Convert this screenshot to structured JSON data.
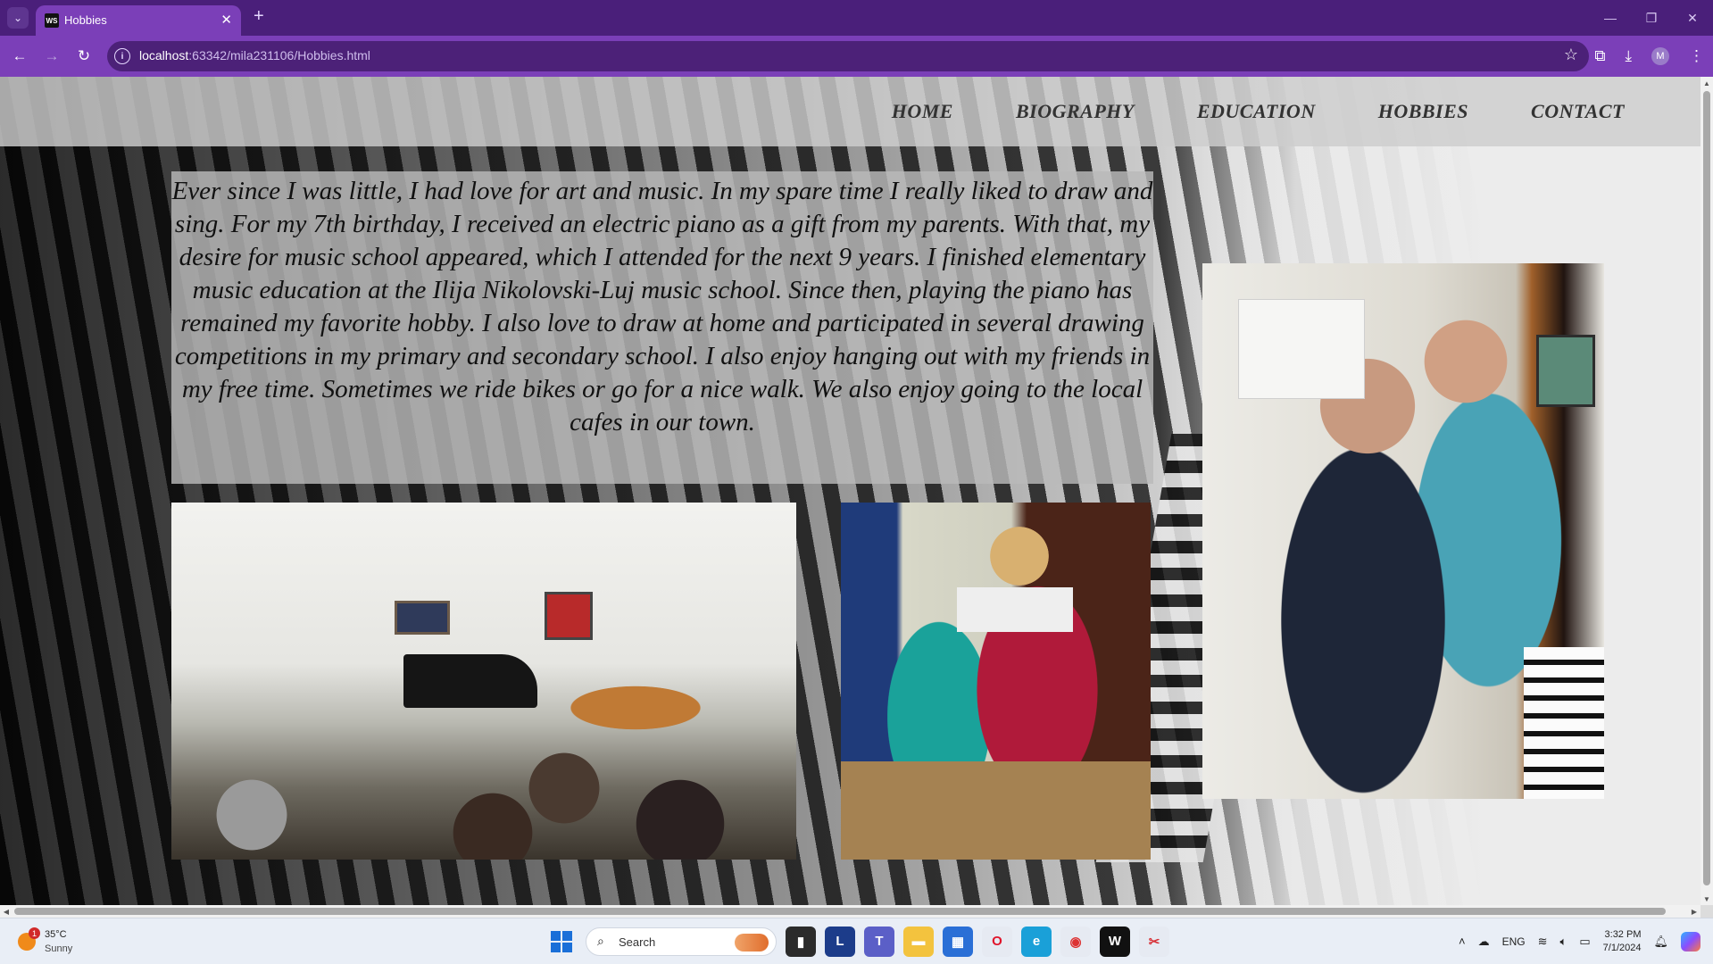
{
  "browser": {
    "tab_title": "Hobbies",
    "tab_favicon": "WS",
    "url_host": "localhost",
    "url_rest": ":63342/mila231106/Hobbies.html",
    "accent": "#7b3fb8",
    "frame": "#4a1f7a"
  },
  "site": {
    "nav": [
      "HOME",
      "BIOGRAPHY",
      "EDUCATION",
      "HOBBIES",
      "CONTACT"
    ],
    "paragraph": "Ever since I was little, I had love for art and music. In my spare time I really liked to draw and sing. For my 7th birthday, I received an electric piano as a gift from my parents. With that, my desire for music school appeared, which I attended for the next 9 years. I finished elementary music education at the Ilija Nikolovski-Luj music school. Since then, playing the piano has remained my favorite hobby. I also love to draw at home and participated in several drawing competitions in my primary and secondary school. I also enjoy hanging out with my friends in my free time. Sometimes we ride bikes or go for a nice walk. We also enjoy going to the local cafes in our town."
  },
  "taskbar": {
    "weather_badge": "1",
    "weather_temp": "35°C",
    "weather_cond": "Sunny",
    "search_label": "Search",
    "lang": "ENG",
    "time": "3:32 PM",
    "date": "7/1/2024",
    "avatar_letter": "M"
  }
}
